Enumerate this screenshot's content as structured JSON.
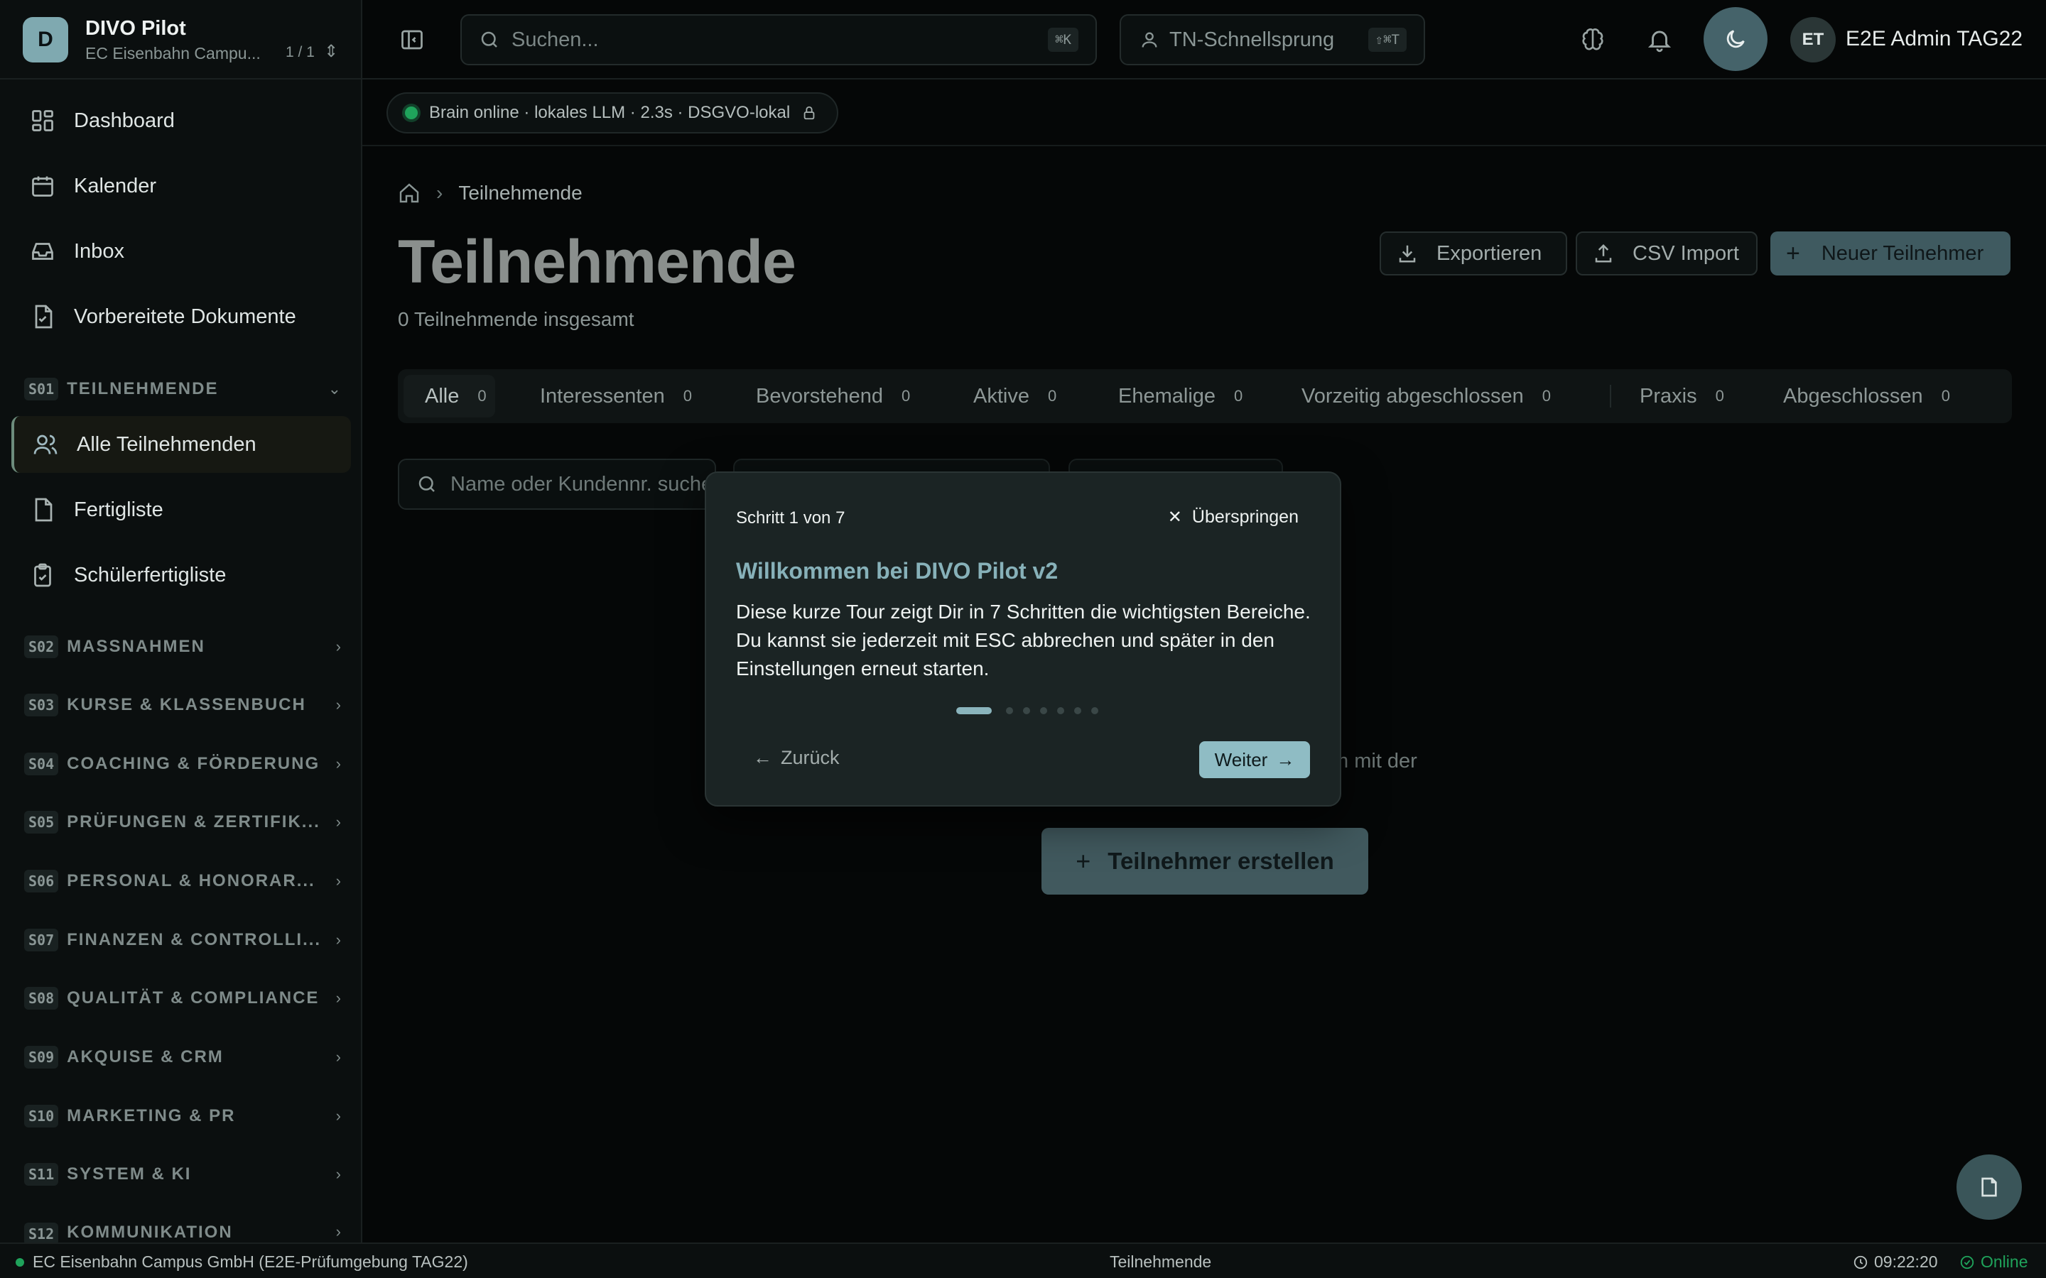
{
  "brand": {
    "logo": "D",
    "name": "DIVO Pilot",
    "tenant": "EC Eisenbahn Campu...",
    "count": "1 / 1"
  },
  "sidebar": {
    "top_items": [
      {
        "label": "Dashboard",
        "icon": "dashboard-icon"
      },
      {
        "label": "Kalender",
        "icon": "calendar-icon"
      },
      {
        "label": "Inbox",
        "icon": "inbox-icon"
      },
      {
        "label": "Vorbereitete Dokumente",
        "icon": "document-check-icon"
      }
    ],
    "section_open": {
      "code": "S01",
      "label": "TEILNEHMENDE"
    },
    "sub_items": [
      {
        "label": "Alle Teilnehmenden",
        "icon": "users-icon"
      },
      {
        "label": "Fertigliste",
        "icon": "file-icon"
      },
      {
        "label": "Schülerfertigliste",
        "icon": "clipboard-check-icon"
      }
    ],
    "sections": [
      {
        "code": "S02",
        "label": "MASSNAHMEN"
      },
      {
        "code": "S03",
        "label": "KURSE & KLASSENBUCH"
      },
      {
        "code": "S04",
        "label": "COACHING & FÖRDERUNG"
      },
      {
        "code": "S05",
        "label": "PRÜFUNGEN & ZERTIFIK..."
      },
      {
        "code": "S06",
        "label": "PERSONAL & HONORAR..."
      },
      {
        "code": "S07",
        "label": "FINANZEN & CONTROLLI..."
      },
      {
        "code": "S08",
        "label": "QUALITÄT & COMPLIANCE"
      },
      {
        "code": "S09",
        "label": "AKQUISE & CRM"
      },
      {
        "code": "S10",
        "label": "MARKETING & PR"
      },
      {
        "code": "S11",
        "label": "SYSTEM & KI"
      },
      {
        "code": "S12",
        "label": "KOMMUNIKATION"
      }
    ]
  },
  "topbar": {
    "search_placeholder": "Suchen...",
    "search_shortcut": "⌘K",
    "jump_label": "TN-Schnellsprung",
    "jump_shortcut": "⇧⌘T",
    "user_initials": "ET",
    "user_name": "E2E Admin TAG22"
  },
  "status": {
    "text": "Brain online · lokales LLM · 2.3s · DSGVO-lokal",
    "color": "#1fa35b"
  },
  "main": {
    "breadcrumb": "Teilnehmende",
    "title": "Teilnehmende",
    "subtitle": "0 Teilnehmende insgesamt",
    "actions": {
      "export": "Exportieren",
      "import": "CSV Import",
      "new": "Neuer Teilnehmer"
    },
    "tabs": [
      {
        "label": "Alle",
        "count": "0"
      },
      {
        "label": "Interessenten",
        "count": "0"
      },
      {
        "label": "Bevorstehend",
        "count": "0"
      },
      {
        "label": "Aktive",
        "count": "0"
      },
      {
        "label": "Ehemalige",
        "count": "0"
      },
      {
        "label": "Vorzeitig abgeschlossen",
        "count": "0"
      },
      {
        "label": "Praxis",
        "count": "0"
      },
      {
        "label": "Abgeschlossen",
        "count": "0"
      }
    ],
    "filter_placeholder": "Name oder Kundennr. suchen...",
    "empty_fragment": "m mit der",
    "create_button": "Teilnehmer erstellen"
  },
  "tour": {
    "step": "Schritt 1 von 7",
    "skip": "Überspringen",
    "title": "Willkommen bei DIVO Pilot v2",
    "body": "Diese kurze Tour zeigt Dir in 7 Schritten die wichtigsten Bereiche. Du kannst sie jederzeit mit ESC abbrechen und später in den Einstellungen erneut starten.",
    "total_steps": 7,
    "current_step": 1,
    "back": "Zurück",
    "next": "Weiter"
  },
  "footer": {
    "org": "EC Eisenbahn Campus GmbH (E2E-Prüfumgebung TAG22)",
    "page": "Teilnehmende",
    "time": "09:22:20",
    "online": "Online"
  },
  "colors": {
    "accent": "#8fbcc4",
    "online": "#1fa35b",
    "primary_button": "#3f5a60"
  }
}
